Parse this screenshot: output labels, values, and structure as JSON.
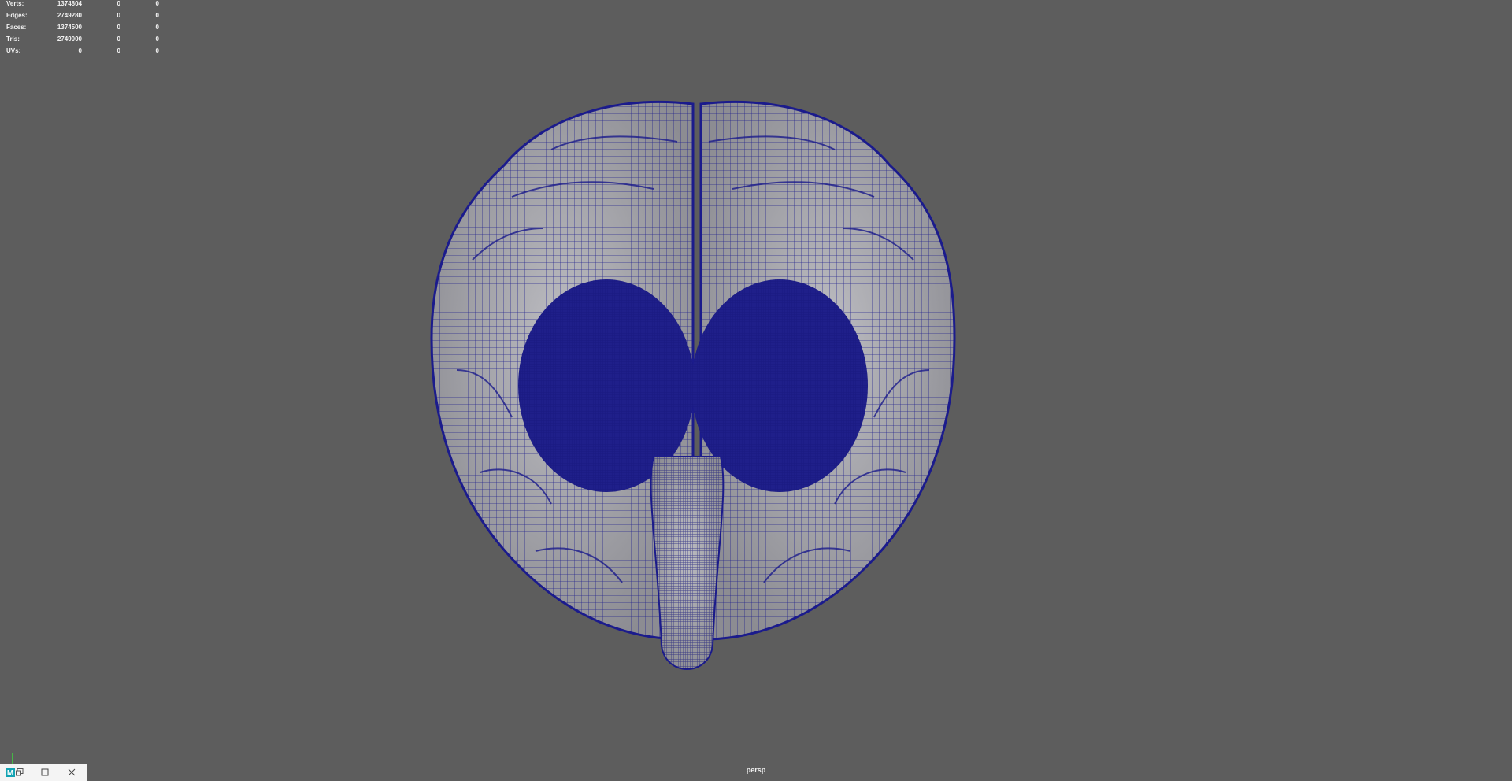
{
  "hud": {
    "rows": [
      {
        "label": "Verts:",
        "v1": "1374804",
        "v2": "0",
        "v3": "0"
      },
      {
        "label": "Edges:",
        "v1": "2749280",
        "v2": "0",
        "v3": "0"
      },
      {
        "label": "Faces:",
        "v1": "1374500",
        "v2": "0",
        "v3": "0"
      },
      {
        "label": "Tris:",
        "v1": "2749000",
        "v2": "0",
        "v3": "0"
      },
      {
        "label": "UVs:",
        "v1": "0",
        "v2": "0",
        "v3": "0"
      }
    ]
  },
  "viewport": {
    "camera_label": "persp",
    "background_color": "#5d5d5d",
    "wire_color": "#1b1b8c",
    "mesh_color": "#a8a8ac"
  },
  "taskbar": {
    "icons": [
      "maya-app-icon",
      "restore-icon",
      "maximize-icon",
      "close-icon"
    ]
  }
}
